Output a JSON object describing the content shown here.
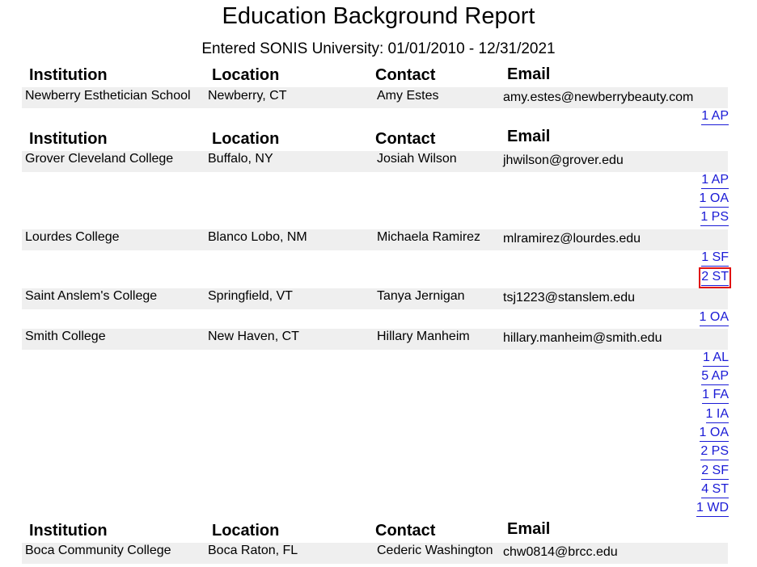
{
  "report": {
    "title": "Education Background Report",
    "subtitle": "Entered SONIS University: 01/01/2010 - 12/31/2021",
    "headers": {
      "institution": "Institution",
      "location": "Location",
      "contact": "Contact",
      "email": "Email"
    }
  },
  "rows": [
    {
      "institution": "Newberry Esthetician School",
      "location": "Newberry, CT",
      "contact": "Amy Estes",
      "email": "amy.estes@newberrybeauty.com",
      "links": [
        "1 AP"
      ]
    },
    {
      "institution": "Grover Cleveland College",
      "location": "Buffalo, NY",
      "contact": "Josiah Wilson",
      "email": "jhwilson@grover.edu",
      "links": [
        "1 AP",
        "1 OA",
        "1 PS"
      ]
    },
    {
      "institution": "Lourdes College",
      "location": "Blanco Lobo, NM",
      "contact": "Michaela Ramirez",
      "email": "mlramirez@lourdes.edu",
      "links": [
        "1 SF",
        "2 ST"
      ]
    },
    {
      "institution": "Saint Anslem's College",
      "location": "Springfield, VT",
      "contact": "Tanya Jernigan",
      "email": "tsj1223@stanslem.edu",
      "links": [
        "1 OA"
      ]
    },
    {
      "institution": "Smith College",
      "location": "New Haven, CT",
      "contact": "Hillary Manheim",
      "email": "hillary.manheim@smith.edu",
      "links": [
        "1 AL",
        "5 AP",
        "1 FA",
        "1 IA",
        "1 OA",
        "2 PS",
        "2 SF",
        "4 ST",
        "1 WD"
      ]
    },
    {
      "institution": "Boca Community College",
      "location": "Boca Raton, FL",
      "contact": "Cederic Washington",
      "email": "chw0814@brcc.edu",
      "links": []
    }
  ],
  "selected_link": "2 ST"
}
